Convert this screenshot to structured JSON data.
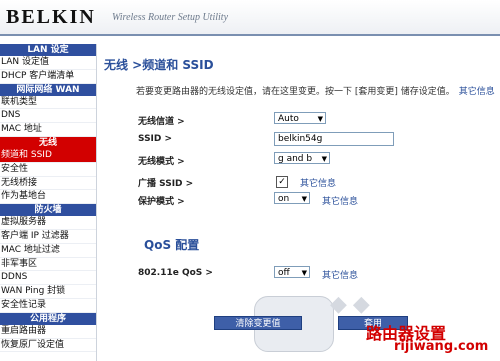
{
  "header": {
    "logo": "BELKIN",
    "tagline": "Wireless Router Setup Utility"
  },
  "sidebar": {
    "lan_section": "LAN 设定",
    "lan_items": [
      "LAN 设定值",
      "DHCP 客户端清单"
    ],
    "wan_section": "网际网络 WAN",
    "wan_items": [
      "联机类型",
      "DNS",
      "MAC 地址"
    ],
    "wireless_section": "无线",
    "wireless_items": [
      "频道和 SSID",
      "安全性",
      "无线桥接",
      "作为基地台"
    ],
    "firewall_section": "防火墙",
    "firewall_items": [
      "虚拟服务器",
      "客户端 IP 过滤器",
      "MAC 地址过滤",
      "非军事区",
      "DDNS",
      "WAN Ping 封锁",
      "安全性记录"
    ],
    "utility_section": "公用程序",
    "utility_items": [
      "重启路由器",
      "恢复原厂设定值"
    ]
  },
  "main": {
    "title": "无线 >频道和 SSID",
    "description": "若要变更路由器的无线设定值，请在这里变更。按一下 [套用变更] 储存设定值。",
    "description_more": "其它信息",
    "channel_label": "无线信道 >",
    "channel_value": "Auto",
    "ssid_label": "SSID >",
    "ssid_value": "belkin54g",
    "mode_label": "无线模式 >",
    "mode_value": "g and b",
    "broadcast_label": "广播 SSID >",
    "broadcast_checked": "✓",
    "broadcast_more": "其它信息",
    "protect_label": "保护模式 >",
    "protect_value": "on",
    "protect_more": "其它信息",
    "qos_title": "QoS 配置",
    "qos_label": "802.11e QoS >",
    "qos_value": "off",
    "qos_more": "其它信息",
    "clear_button": "清除变更值",
    "apply_button": "套用"
  },
  "watermark": {
    "line1": "路由器设置",
    "line2": "rijiwang.com"
  },
  "colors": {
    "nav_blue": "#2f4f9f",
    "active_red": "#d20000",
    "title_blue": "#2a4f9a"
  }
}
